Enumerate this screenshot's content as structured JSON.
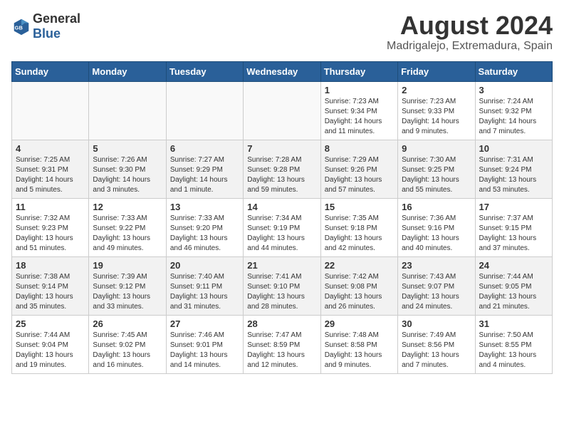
{
  "logo": {
    "text_general": "General",
    "text_blue": "Blue"
  },
  "title": "August 2024",
  "subtitle": "Madrigalejo, Extremadura, Spain",
  "days_of_week": [
    "Sunday",
    "Monday",
    "Tuesday",
    "Wednesday",
    "Thursday",
    "Friday",
    "Saturday"
  ],
  "weeks": [
    [
      {
        "day": "",
        "content": ""
      },
      {
        "day": "",
        "content": ""
      },
      {
        "day": "",
        "content": ""
      },
      {
        "day": "",
        "content": ""
      },
      {
        "day": "1",
        "content": "Sunrise: 7:23 AM\nSunset: 9:34 PM\nDaylight: 14 hours\nand 11 minutes."
      },
      {
        "day": "2",
        "content": "Sunrise: 7:23 AM\nSunset: 9:33 PM\nDaylight: 14 hours\nand 9 minutes."
      },
      {
        "day": "3",
        "content": "Sunrise: 7:24 AM\nSunset: 9:32 PM\nDaylight: 14 hours\nand 7 minutes."
      }
    ],
    [
      {
        "day": "4",
        "content": "Sunrise: 7:25 AM\nSunset: 9:31 PM\nDaylight: 14 hours\nand 5 minutes."
      },
      {
        "day": "5",
        "content": "Sunrise: 7:26 AM\nSunset: 9:30 PM\nDaylight: 14 hours\nand 3 minutes."
      },
      {
        "day": "6",
        "content": "Sunrise: 7:27 AM\nSunset: 9:29 PM\nDaylight: 14 hours\nand 1 minute."
      },
      {
        "day": "7",
        "content": "Sunrise: 7:28 AM\nSunset: 9:28 PM\nDaylight: 13 hours\nand 59 minutes."
      },
      {
        "day": "8",
        "content": "Sunrise: 7:29 AM\nSunset: 9:26 PM\nDaylight: 13 hours\nand 57 minutes."
      },
      {
        "day": "9",
        "content": "Sunrise: 7:30 AM\nSunset: 9:25 PM\nDaylight: 13 hours\nand 55 minutes."
      },
      {
        "day": "10",
        "content": "Sunrise: 7:31 AM\nSunset: 9:24 PM\nDaylight: 13 hours\nand 53 minutes."
      }
    ],
    [
      {
        "day": "11",
        "content": "Sunrise: 7:32 AM\nSunset: 9:23 PM\nDaylight: 13 hours\nand 51 minutes."
      },
      {
        "day": "12",
        "content": "Sunrise: 7:33 AM\nSunset: 9:22 PM\nDaylight: 13 hours\nand 49 minutes."
      },
      {
        "day": "13",
        "content": "Sunrise: 7:33 AM\nSunset: 9:20 PM\nDaylight: 13 hours\nand 46 minutes."
      },
      {
        "day": "14",
        "content": "Sunrise: 7:34 AM\nSunset: 9:19 PM\nDaylight: 13 hours\nand 44 minutes."
      },
      {
        "day": "15",
        "content": "Sunrise: 7:35 AM\nSunset: 9:18 PM\nDaylight: 13 hours\nand 42 minutes."
      },
      {
        "day": "16",
        "content": "Sunrise: 7:36 AM\nSunset: 9:16 PM\nDaylight: 13 hours\nand 40 minutes."
      },
      {
        "day": "17",
        "content": "Sunrise: 7:37 AM\nSunset: 9:15 PM\nDaylight: 13 hours\nand 37 minutes."
      }
    ],
    [
      {
        "day": "18",
        "content": "Sunrise: 7:38 AM\nSunset: 9:14 PM\nDaylight: 13 hours\nand 35 minutes."
      },
      {
        "day": "19",
        "content": "Sunrise: 7:39 AM\nSunset: 9:12 PM\nDaylight: 13 hours\nand 33 minutes."
      },
      {
        "day": "20",
        "content": "Sunrise: 7:40 AM\nSunset: 9:11 PM\nDaylight: 13 hours\nand 31 minutes."
      },
      {
        "day": "21",
        "content": "Sunrise: 7:41 AM\nSunset: 9:10 PM\nDaylight: 13 hours\nand 28 minutes."
      },
      {
        "day": "22",
        "content": "Sunrise: 7:42 AM\nSunset: 9:08 PM\nDaylight: 13 hours\nand 26 minutes."
      },
      {
        "day": "23",
        "content": "Sunrise: 7:43 AM\nSunset: 9:07 PM\nDaylight: 13 hours\nand 24 minutes."
      },
      {
        "day": "24",
        "content": "Sunrise: 7:44 AM\nSunset: 9:05 PM\nDaylight: 13 hours\nand 21 minutes."
      }
    ],
    [
      {
        "day": "25",
        "content": "Sunrise: 7:44 AM\nSunset: 9:04 PM\nDaylight: 13 hours\nand 19 minutes."
      },
      {
        "day": "26",
        "content": "Sunrise: 7:45 AM\nSunset: 9:02 PM\nDaylight: 13 hours\nand 16 minutes."
      },
      {
        "day": "27",
        "content": "Sunrise: 7:46 AM\nSunset: 9:01 PM\nDaylight: 13 hours\nand 14 minutes."
      },
      {
        "day": "28",
        "content": "Sunrise: 7:47 AM\nSunset: 8:59 PM\nDaylight: 13 hours\nand 12 minutes."
      },
      {
        "day": "29",
        "content": "Sunrise: 7:48 AM\nSunset: 8:58 PM\nDaylight: 13 hours\nand 9 minutes."
      },
      {
        "day": "30",
        "content": "Sunrise: 7:49 AM\nSunset: 8:56 PM\nDaylight: 13 hours\nand 7 minutes."
      },
      {
        "day": "31",
        "content": "Sunrise: 7:50 AM\nSunset: 8:55 PM\nDaylight: 13 hours\nand 4 minutes."
      }
    ]
  ]
}
